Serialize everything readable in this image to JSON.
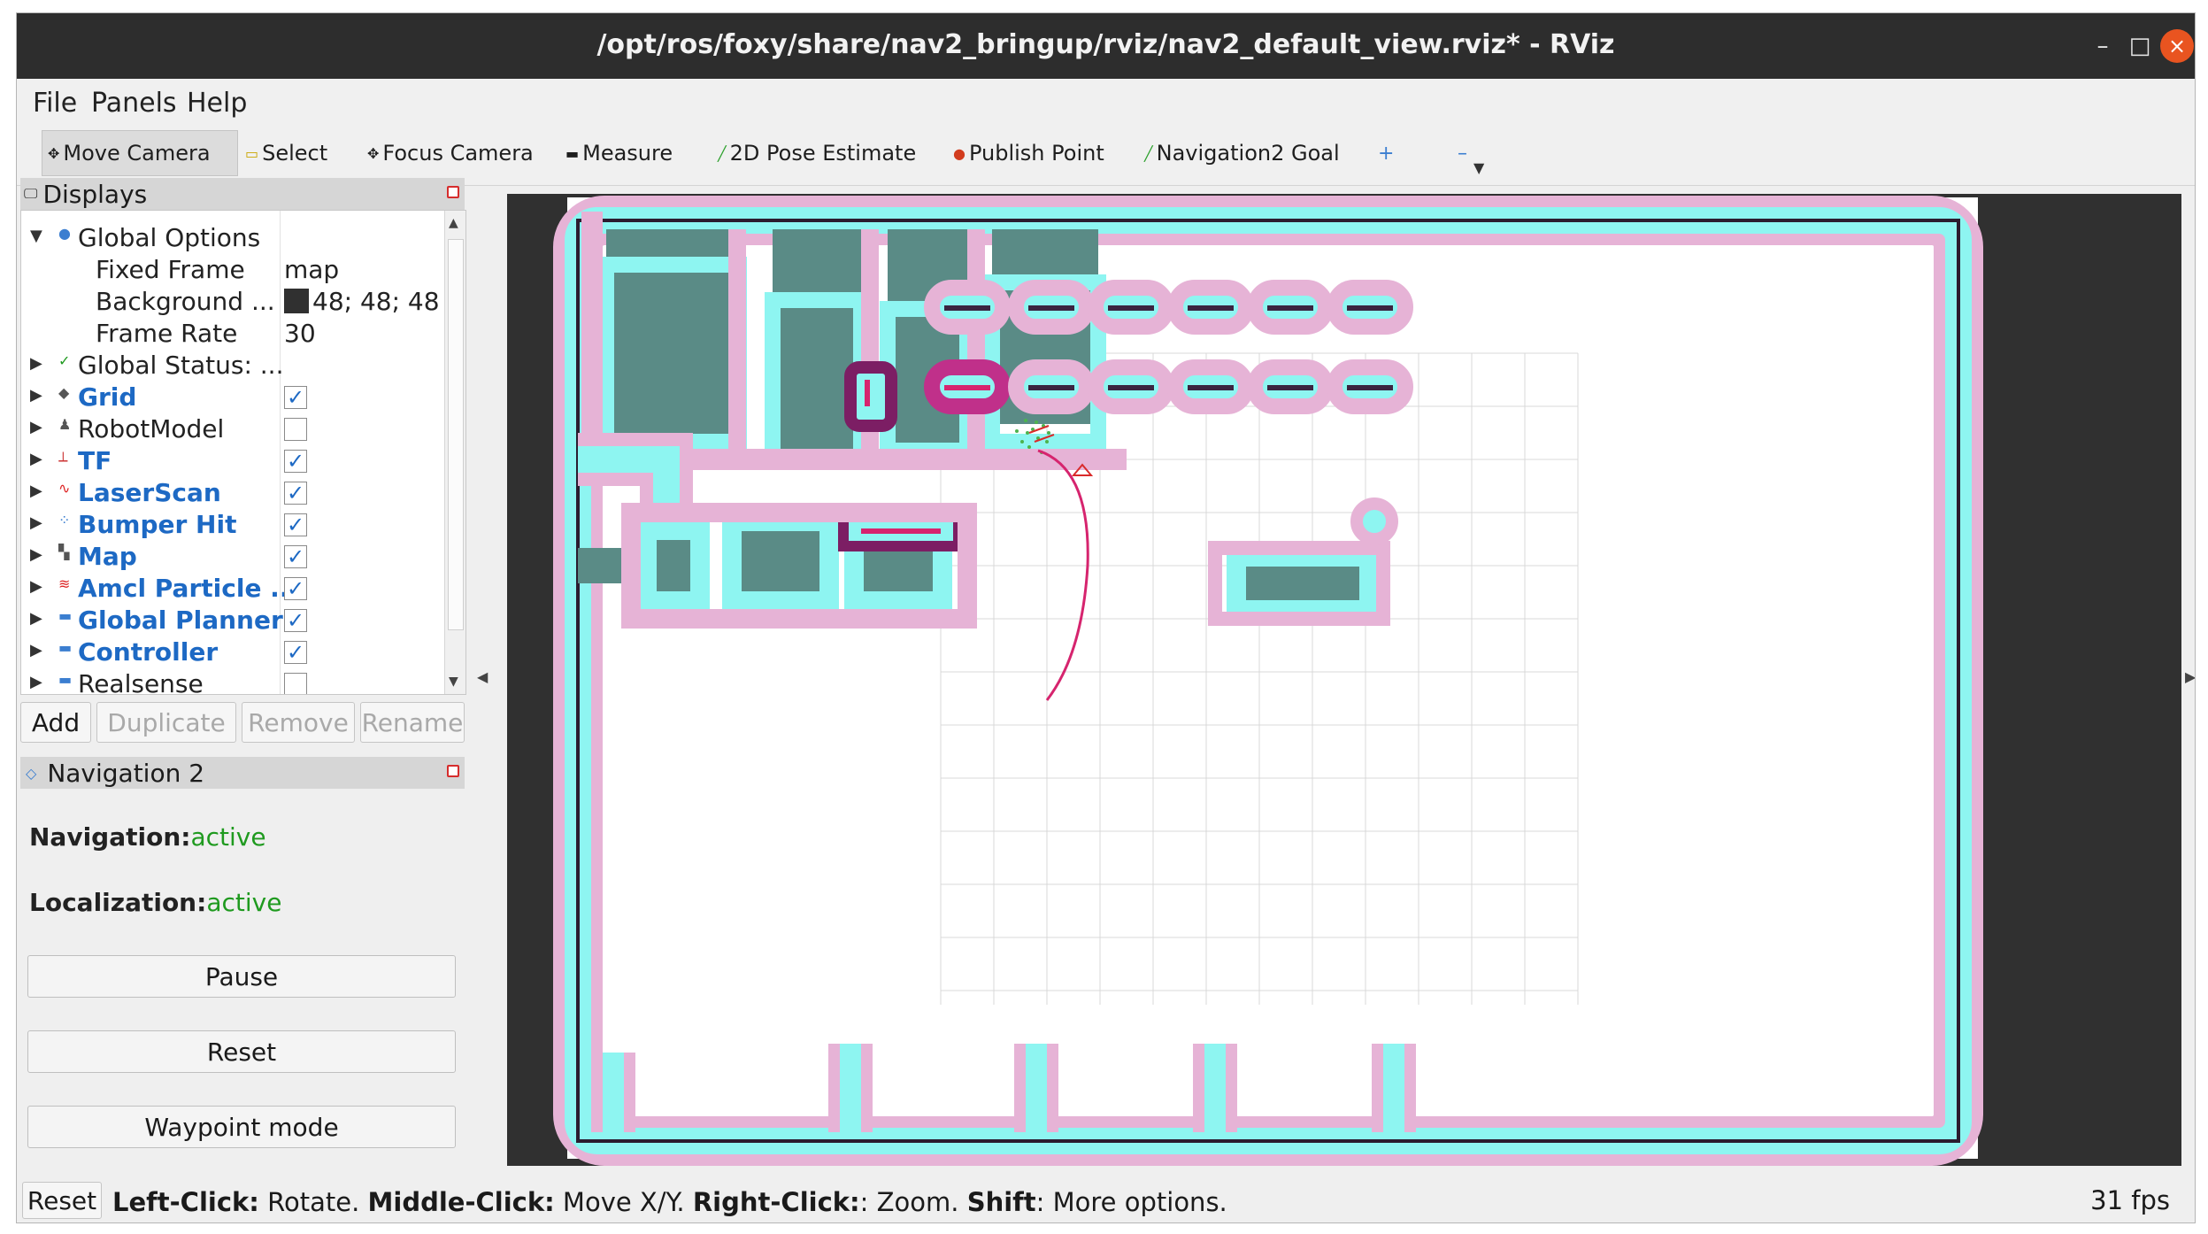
{
  "window": {
    "title": "/opt/ros/foxy/share/nav2_bringup/rviz/nav2_default_view.rviz* - RViz",
    "minimize": "–",
    "maximize": "□",
    "close": "×"
  },
  "menu": {
    "file": "File",
    "panels": "Panels",
    "help": "Help"
  },
  "toolbar": {
    "move_camera": "Move Camera",
    "select": "Select",
    "focus_camera": "Focus Camera",
    "measure": "Measure",
    "pose_estimate": "2D Pose Estimate",
    "publish_point": "Publish Point",
    "nav_goal": "Navigation2 Goal",
    "plus": "+",
    "minus": "–"
  },
  "displays": {
    "header": "Displays",
    "rows": [
      {
        "label": "Global Options",
        "value": ""
      },
      {
        "label": "Fixed Frame",
        "value": "map"
      },
      {
        "label": "Background ...",
        "value": "48; 48; 48"
      },
      {
        "label": "Frame Rate",
        "value": "30"
      },
      {
        "label": "Global Status: ...",
        "value": ""
      },
      {
        "label": "Grid",
        "checked": "✓"
      },
      {
        "label": "RobotModel",
        "checked": ""
      },
      {
        "label": "TF",
        "checked": "✓"
      },
      {
        "label": "LaserScan",
        "checked": "✓"
      },
      {
        "label": "Bumper Hit",
        "checked": "✓"
      },
      {
        "label": "Map",
        "checked": "✓"
      },
      {
        "label": "Amcl Particle ...",
        "checked": "✓"
      },
      {
        "label": "Global Planner",
        "checked": "✓"
      },
      {
        "label": "Controller",
        "checked": "✓"
      },
      {
        "label": "Realsense",
        "checked": ""
      }
    ],
    "background_color": "#303030",
    "buttons": {
      "add": "Add",
      "duplicate": "Duplicate",
      "remove": "Remove",
      "rename": "Rename"
    }
  },
  "nav2": {
    "header": "Navigation 2",
    "navigation_label": "Navigation:",
    "navigation_status": "active",
    "localization_label": "Localization:",
    "localization_status": "active",
    "pause": "Pause",
    "reset": "Reset",
    "waypoint": "Waypoint mode"
  },
  "status": {
    "reset": "Reset",
    "left": "Left-Click:",
    "left_action": " Rotate. ",
    "middle": "Middle-Click:",
    "middle_action": " Move X/Y. ",
    "right": "Right-Click:",
    "right_action": ": Zoom. ",
    "shift": "Shift",
    "shift_action": ": More options.",
    "fps": "31 fps"
  },
  "colors": {
    "accent": "#1d69c4",
    "active": "#1f9a1f",
    "close": "#e95420",
    "inflation": "#8ef5f1",
    "cost": "#e6b3d6",
    "lethal": "#6a1b5a",
    "plan": "#d6246e"
  }
}
